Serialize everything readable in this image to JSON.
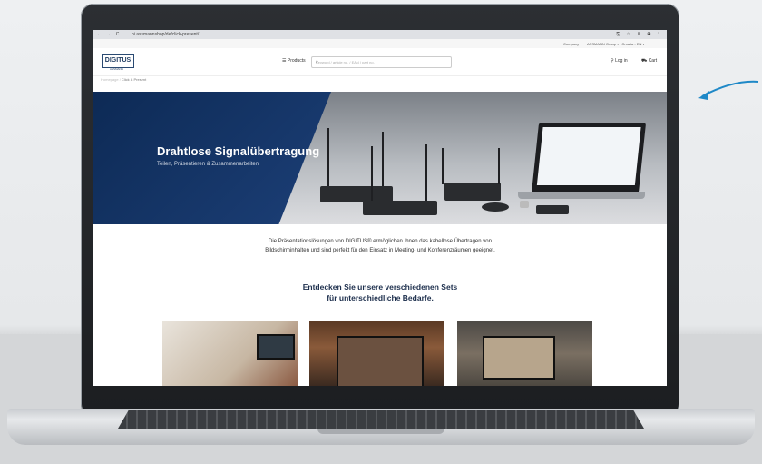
{
  "browser": {
    "nav_icons": "← → C",
    "url": "hi.assmannshop/de/click-present/",
    "controls": "⎘ ☆ ▯ ◉ ⋮"
  },
  "topbar": {
    "company": "Company",
    "group": "ASSMANN Group ▾ | Croatia - EN ▾"
  },
  "header": {
    "logo": "DIGITUS",
    "logo_sub": "ASSMANN",
    "products": "Products",
    "search_placeholder": "Keyword / article no. / EAN / part no.",
    "login": "Log in",
    "cart": "Cart"
  },
  "breadcrumb": {
    "home": "Homepage",
    "current": "Click & Present"
  },
  "hero": {
    "title": "Drahtlose Signalübertragung",
    "subtitle": "Teilen, Präsentieren & Zusammenarbeiten"
  },
  "intro": {
    "line1": "Die Präsentationslösungen von DIGITUS® ermöglichen Ihnen das kabellose Übertragen von",
    "line2": "Bildschirminhalten und sind perfekt für den Einsatz in Meeting- und Konferenzräumen geeignet."
  },
  "sets": {
    "line1": "Entdecken Sie unsere verschiedenen Sets",
    "line2": "für unterschiedliche Bedarfe."
  },
  "colors": {
    "brand": "#1d2f4d",
    "hero_blue": "#0d2a55",
    "arrow": "#1e88c7"
  }
}
